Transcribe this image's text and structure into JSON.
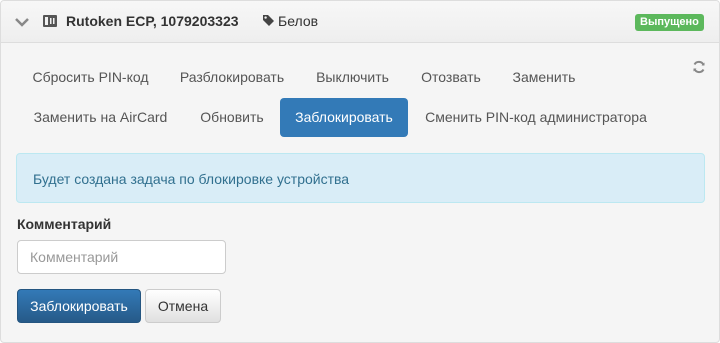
{
  "header": {
    "device_title": "Rutoken ECP, 1079203323",
    "owner": "Белов",
    "status_badge": "Выпущено",
    "status_color": "#5cb85c",
    "icons": [
      "chevron-down-icon",
      "token-device-icon",
      "tag-icon",
      "refresh-icon"
    ]
  },
  "actions": {
    "row1": [
      "Сбросить PIN-код",
      "Разблокировать",
      "Выключить",
      "Отозвать",
      "Заменить"
    ],
    "row2": [
      "Заменить на AirCard",
      "Обновить",
      "Заблокировать",
      "Сменить PIN-код администратора"
    ],
    "active": "Заблокировать"
  },
  "alert": {
    "text": "Будет создана задача по блокировке устройства"
  },
  "form": {
    "comment_label": "Комментарий",
    "comment_placeholder": "Комментарий",
    "comment_value": "",
    "submit_label": "Заблокировать",
    "cancel_label": "Отмена"
  },
  "colors": {
    "primary": "#337ab7",
    "info_bg": "#d9edf7",
    "info_text": "#31708f"
  }
}
